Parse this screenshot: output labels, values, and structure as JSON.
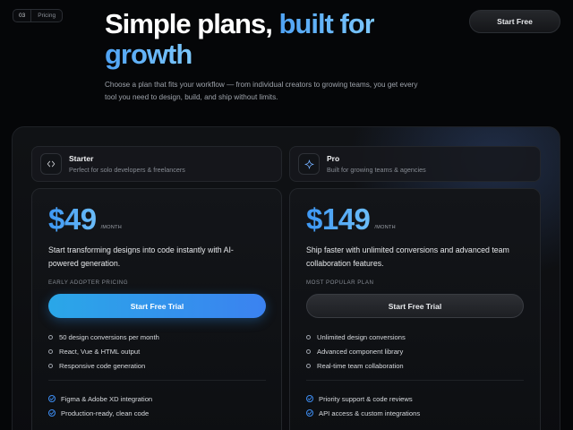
{
  "section_tag": {
    "number": "03",
    "label": "Pricing"
  },
  "hero": {
    "title_plain": "Simple plans, ",
    "title_highlight_1": "built for",
    "title_highlight_2": "growth",
    "description": "Choose a plan that fits your workflow — from individual creators to growing teams, you get every tool you need to design, build, and ship without limits."
  },
  "header": {
    "cta_label": "Start Free"
  },
  "colors": {
    "accent_blue": "#3b8ef3",
    "accent_cyan": "#2aa7e8",
    "background": "#050608"
  },
  "plans": [
    {
      "icon": "code-brackets-icon",
      "name": "Starter",
      "subtitle": "Perfect for solo developers & freelancers",
      "price": "$49",
      "period": "/MONTH",
      "description": "Start transforming designs into code instantly with AI-powered generation.",
      "kicker": "EARLY ADOPTER PRICING",
      "cta_label": "Start Free Trial",
      "features": [
        "50 design conversions per month",
        "React, Vue & HTML output",
        "Responsive code generation"
      ],
      "extras": [
        "Figma & Adobe XD integration",
        "Production-ready, clean code"
      ]
    },
    {
      "icon": "sparkle-icon",
      "name": "Pro",
      "subtitle": "Built for growing teams & agencies",
      "price": "$149",
      "period": "/MONTH",
      "description": "Ship faster with unlimited conversions and advanced team collaboration features.",
      "kicker": "MOST POPULAR PLAN",
      "cta_label": "Start Free Trial",
      "features": [
        "Unlimited design conversions",
        "Advanced component library",
        "Real-time team collaboration"
      ],
      "extras": [
        "Priority support & code reviews",
        "API access & custom integrations"
      ]
    }
  ]
}
